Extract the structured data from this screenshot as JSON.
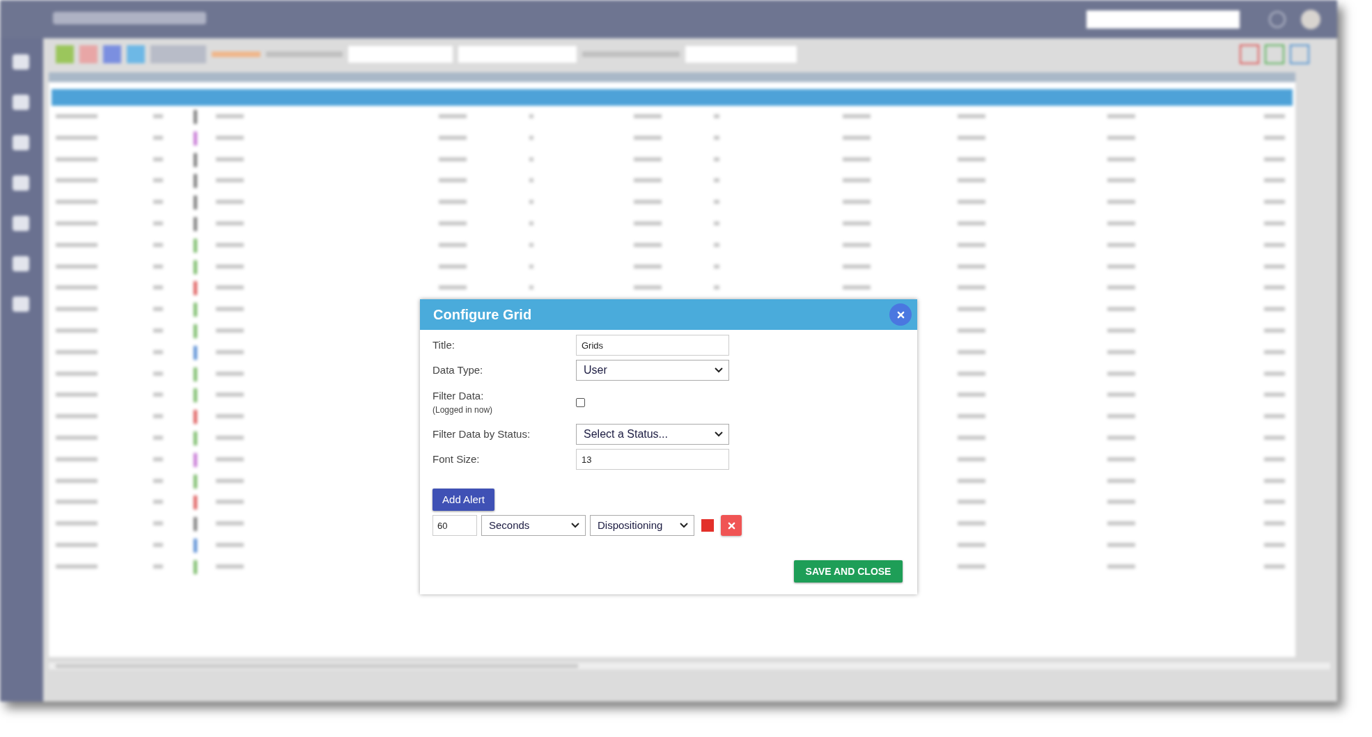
{
  "dialog": {
    "title": "Configure Grid",
    "fields": [
      {
        "kind": "text",
        "label": "Title:",
        "value": "Grids"
      },
      {
        "kind": "select",
        "label": "Data Type:",
        "value": "User"
      },
      {
        "kind": "checkbox",
        "label": "Filter Data:",
        "sublabel": "(Logged in now)",
        "checked": false
      },
      {
        "kind": "select",
        "label": "Filter Data by Status:",
        "value": "Select a Status..."
      },
      {
        "kind": "text",
        "label": "Font Size:",
        "value": "13"
      }
    ],
    "add_alert_button": "Add Alert",
    "alerts": [
      {
        "value": "60",
        "unit": "Seconds",
        "status": "Dispositioning",
        "color": "#e3302a"
      }
    ],
    "save_button": "SAVE AND CLOSE"
  }
}
